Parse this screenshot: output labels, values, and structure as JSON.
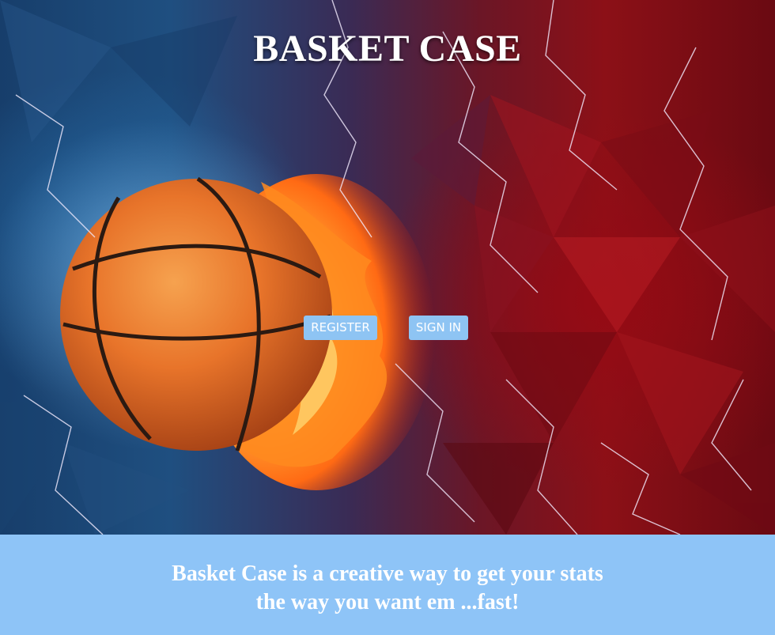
{
  "header": {
    "title": "BASKET CASE"
  },
  "actions": {
    "register_label": "REGISTER",
    "signin_label": "SIGN IN"
  },
  "footer": {
    "tagline_line1": "Basket Case is a creative way to get your stats",
    "tagline_line2": "the way you want em ...fast!"
  },
  "colors": {
    "button_bg": "#8ec4f3",
    "footer_bg": "#8ec4f7",
    "text": "#ffffff",
    "ball_orange": "#e8742a",
    "fire_orange": "#ff8a1e",
    "water_blue": "#1f4f80",
    "red_background": "#8c1017"
  },
  "background_image": {
    "subject": "basketball engulfed in fire and water splash with lightning"
  }
}
